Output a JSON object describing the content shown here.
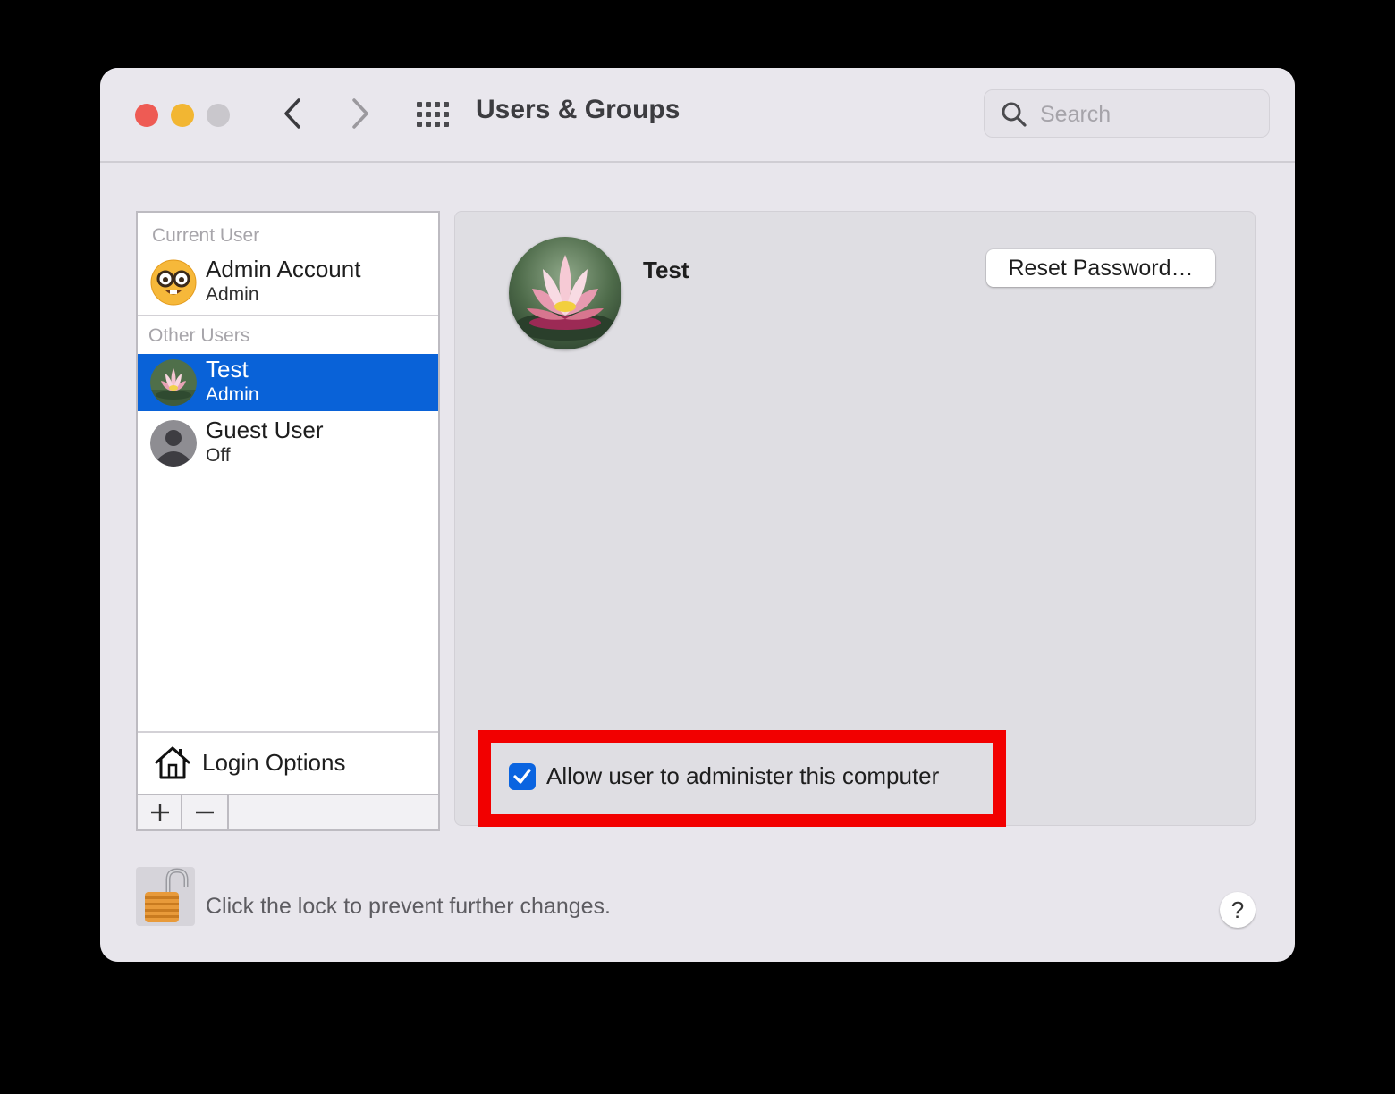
{
  "window": {
    "title": "Users & Groups"
  },
  "toolbar": {
    "back_icon": "chevron-left-icon",
    "forward_icon": "chevron-right-icon",
    "show_all_icon": "grid-icon",
    "search": {
      "placeholder": "Search",
      "value": ""
    }
  },
  "sidebar": {
    "current_user_header": "Current User",
    "current_user": {
      "name": "Admin Account",
      "role": "Admin",
      "avatar": "nerd-face-emoji"
    },
    "other_users_header": "Other Users",
    "other_users": [
      {
        "name": "Test",
        "role": "Admin",
        "avatar": "lotus-flower-photo",
        "selected": true
      },
      {
        "name": "Guest User",
        "role": "Off",
        "avatar": "person-silhouette-icon",
        "selected": false
      }
    ],
    "login_options": "Login Options",
    "add_icon": "plus-icon",
    "remove_icon": "minus-icon"
  },
  "detail": {
    "name": "Test",
    "reset_password": "Reset Password…",
    "allow_admin_label": "Allow user to administer this computer",
    "allow_admin_checked": true
  },
  "footer": {
    "lock_text": "Click the lock to prevent further changes.",
    "lock_icon": "unlocked-padlock-icon",
    "help_label": "?"
  },
  "colors": {
    "selection": "#0962d8",
    "highlight": "#f20000",
    "close": "#ee5b54",
    "minimize": "#f2b632",
    "checkbox": "#0a64e0"
  }
}
